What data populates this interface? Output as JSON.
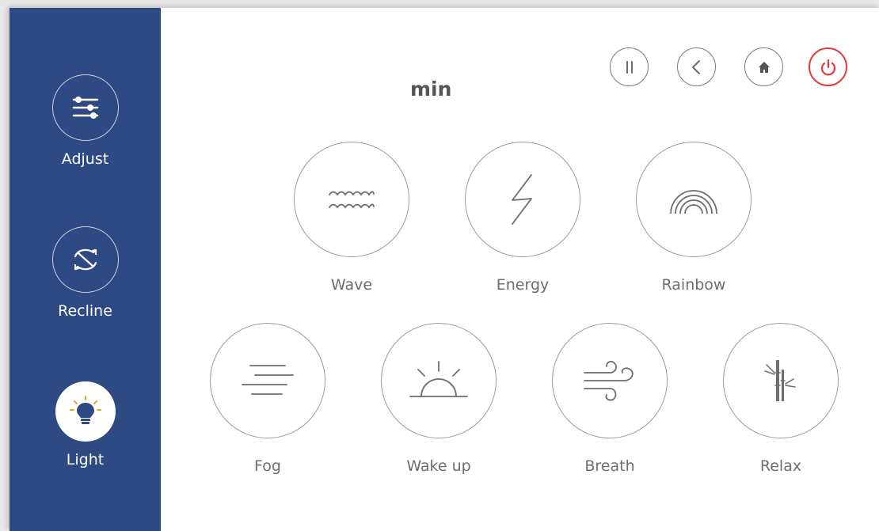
{
  "header": {
    "title": "min"
  },
  "sidebar": {
    "items": [
      {
        "label": "Adjust",
        "icon": "sliders-icon"
      },
      {
        "label": "Recline",
        "icon": "recline-arrows-icon"
      },
      {
        "label": "Light",
        "icon": "lightbulb-icon",
        "active": true
      }
    ]
  },
  "controls": {
    "pause_icon": "pause-icon",
    "back_icon": "chevron-left-icon",
    "home_icon": "home-icon",
    "power_icon": "power-icon"
  },
  "modes": [
    {
      "label": "Wave",
      "icon": "wave-icon"
    },
    {
      "label": "Energy",
      "icon": "lightning-icon"
    },
    {
      "label": "Rainbow",
      "icon": "rainbow-icon"
    },
    {
      "label": "Fog",
      "icon": "fog-icon"
    },
    {
      "label": "Wake up",
      "icon": "sunrise-icon"
    },
    {
      "label": "Breath",
      "icon": "wind-icon"
    },
    {
      "label": "Relax",
      "icon": "bamboo-icon"
    }
  ],
  "colors": {
    "sidebar": "#2e4a83",
    "power": "#e8383d",
    "icon_stroke": "#6d6d6d"
  }
}
